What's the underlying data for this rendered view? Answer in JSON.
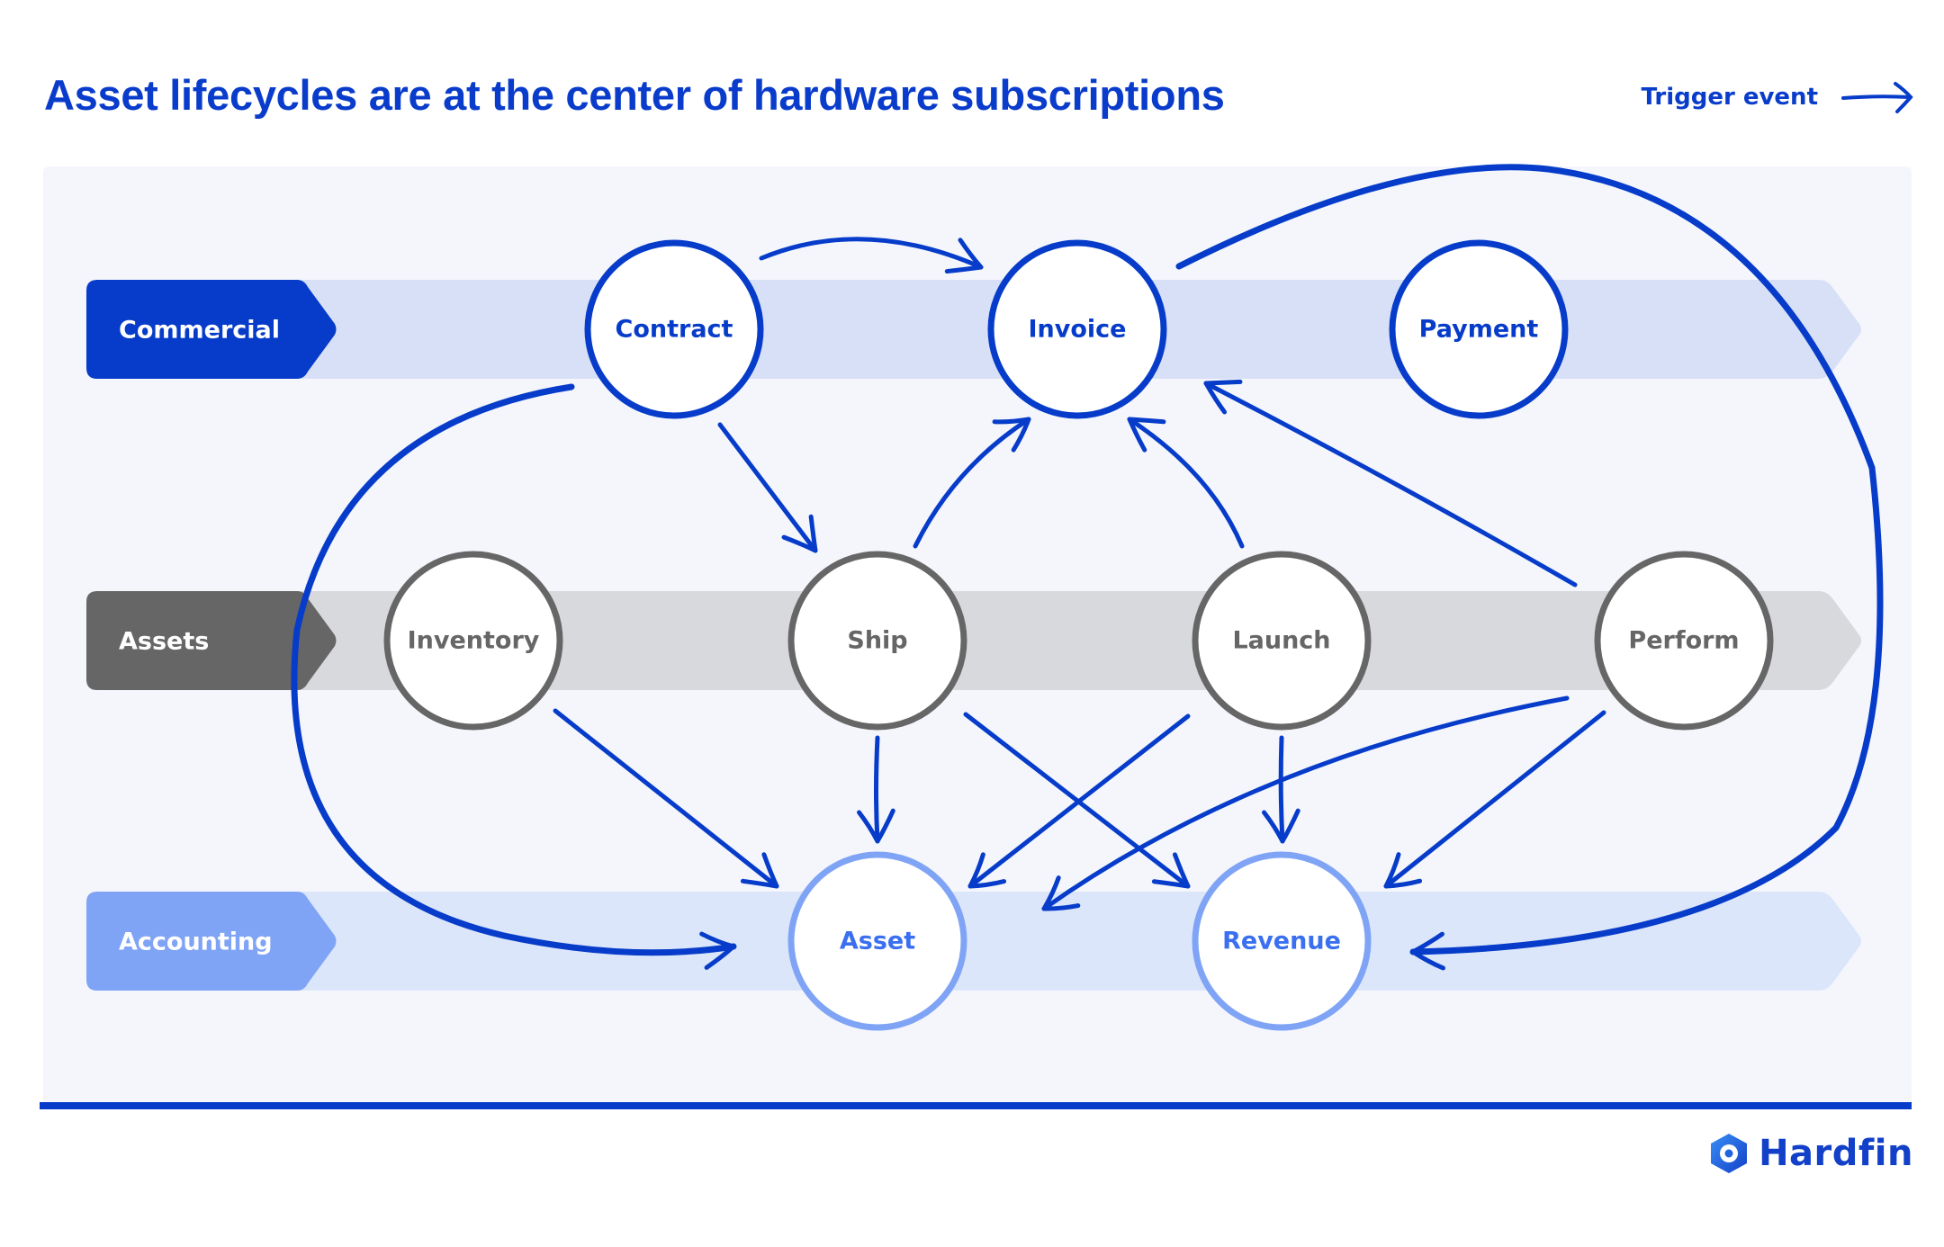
{
  "title": "Asset lifecycles are at the center of hardware subscriptions",
  "legend": {
    "label": "Trigger event",
    "icon": "arrow-right-icon"
  },
  "colors": {
    "primary": "#063cc9",
    "commercial_tag": "#063cc9",
    "commercial_band": "#d8e0f7",
    "assets_tag": "#666666",
    "assets_band": "#d8d9dd",
    "accounting_tag": "#80a4f5",
    "accounting_band": "#dce6fa",
    "panel_bg": "#f4f6fc",
    "commercial_node_stroke": "#063cc9",
    "assets_node_stroke": "#666666",
    "accounting_node_stroke": "#80a4f5",
    "accounting_node_text": "#3a6ff0"
  },
  "lanes": [
    {
      "id": "commercial",
      "label": "Commercial"
    },
    {
      "id": "assets",
      "label": "Assets"
    },
    {
      "id": "accounting",
      "label": "Accounting"
    }
  ],
  "nodes": [
    {
      "id": "contract",
      "label": "Contract",
      "lane": "commercial"
    },
    {
      "id": "invoice",
      "label": "Invoice",
      "lane": "commercial"
    },
    {
      "id": "payment",
      "label": "Payment",
      "lane": "commercial"
    },
    {
      "id": "inventory",
      "label": "Inventory",
      "lane": "assets"
    },
    {
      "id": "ship",
      "label": "Ship",
      "lane": "assets"
    },
    {
      "id": "launch",
      "label": "Launch",
      "lane": "assets"
    },
    {
      "id": "perform",
      "label": "Perform",
      "lane": "assets"
    },
    {
      "id": "asset",
      "label": "Asset",
      "lane": "accounting"
    },
    {
      "id": "revenue",
      "label": "Revenue",
      "lane": "accounting"
    }
  ],
  "edges": [
    {
      "from": "contract",
      "to": "invoice"
    },
    {
      "from": "contract",
      "to": "ship"
    },
    {
      "from": "contract",
      "to": "asset"
    },
    {
      "from": "ship",
      "to": "invoice"
    },
    {
      "from": "launch",
      "to": "invoice"
    },
    {
      "from": "perform",
      "to": "invoice"
    },
    {
      "from": "invoice",
      "to": "revenue"
    },
    {
      "from": "inventory",
      "to": "asset"
    },
    {
      "from": "ship",
      "to": "asset"
    },
    {
      "from": "ship",
      "to": "revenue"
    },
    {
      "from": "launch",
      "to": "asset"
    },
    {
      "from": "launch",
      "to": "revenue"
    },
    {
      "from": "perform",
      "to": "asset"
    },
    {
      "from": "perform",
      "to": "revenue"
    }
  ],
  "brand": {
    "name": "Hardfin",
    "icon": "hardfin-logo-icon"
  }
}
